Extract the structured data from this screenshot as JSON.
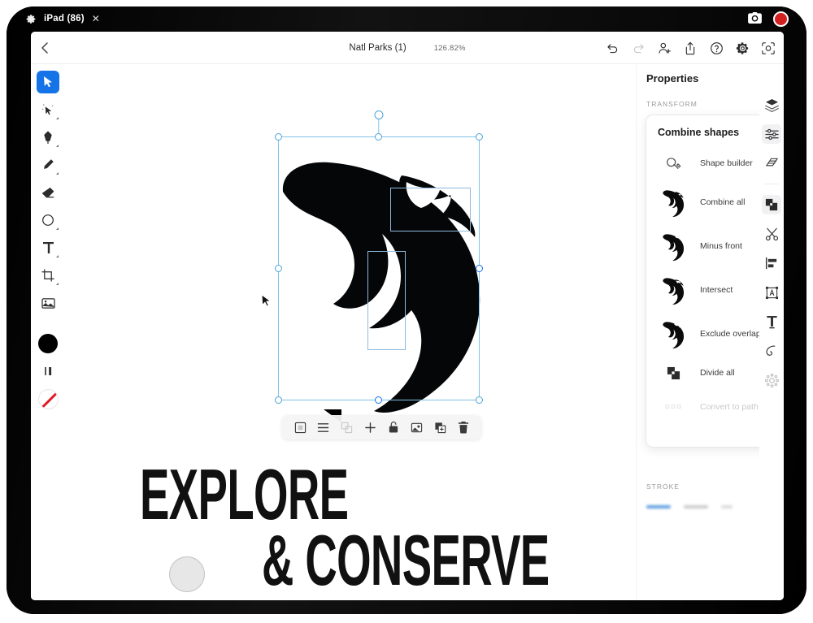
{
  "statusbar": {
    "gear_icon": "gear-icon",
    "device_label": "iPad (86)",
    "close_label": "✕",
    "camera_icon": "camera-icon",
    "record_icon": "record-button"
  },
  "appbar": {
    "back_icon": "chevron-left-icon",
    "doc_title": "Natl Parks (1)",
    "zoom_level": "126.82%",
    "right_icons": [
      {
        "name": "undo-icon",
        "state": "enabled"
      },
      {
        "name": "redo-icon",
        "state": "disabled"
      },
      {
        "name": "add-collaborator-icon",
        "state": "enabled"
      },
      {
        "name": "share-icon",
        "state": "enabled"
      },
      {
        "name": "help-icon",
        "state": "enabled"
      },
      {
        "name": "settings-gear-icon",
        "state": "enabled"
      },
      {
        "name": "preview-icon",
        "state": "enabled"
      }
    ]
  },
  "left_toolbar": {
    "items": [
      {
        "name": "select-tool",
        "label": "Select",
        "active": true
      },
      {
        "name": "direct-select-tool",
        "label": "Direct select",
        "active": false
      },
      {
        "name": "pen-tool",
        "label": "Pen",
        "active": false
      },
      {
        "name": "pencil-tool",
        "label": "Pencil",
        "active": false
      },
      {
        "name": "eraser-tool",
        "label": "Eraser",
        "active": false
      },
      {
        "name": "shape-tool",
        "label": "Shape",
        "active": false
      },
      {
        "name": "text-tool",
        "label": "Type",
        "active": false
      },
      {
        "name": "crop-tool",
        "label": "Crop",
        "active": false
      },
      {
        "name": "image-tool",
        "label": "Place image",
        "active": false
      }
    ],
    "fill_color": "#000000",
    "fill_label": "Fill",
    "stroke_width_label": "Stroke width",
    "stroke_color": "none",
    "stroke_label": "Stroke"
  },
  "canvas": {
    "artwork_name": "fish-silhouette",
    "artwork_color": "#040608",
    "selection": {
      "accent": "#4da3d6",
      "handles": 8,
      "sub_selections": 2
    },
    "headline_line1": "EXPLORE",
    "headline_line2": "& CONSERVE",
    "context_toolbar": [
      {
        "name": "frame-icon",
        "label": "Frame",
        "state": "enabled"
      },
      {
        "name": "list-icon",
        "label": "Arrange",
        "state": "enabled"
      },
      {
        "name": "group-icon",
        "label": "Group",
        "state": "disabled"
      },
      {
        "name": "add-icon",
        "label": "Add",
        "state": "enabled"
      },
      {
        "name": "lock-icon",
        "label": "Lock",
        "state": "enabled"
      },
      {
        "name": "mask-icon",
        "label": "Mask",
        "state": "enabled"
      },
      {
        "name": "duplicate-icon",
        "label": "Duplicate",
        "state": "enabled"
      },
      {
        "name": "trash-icon",
        "label": "Delete",
        "state": "enabled"
      }
    ]
  },
  "properties_panel": {
    "title": "Properties",
    "transform_label": "TRANSFORM",
    "stroke_label": "STROKE",
    "combine_shapes": {
      "header": "Combine shapes",
      "header_arrow": "→",
      "items": [
        {
          "name": "shape-builder-item",
          "label": "Shape builder",
          "thumb": "shape-builder-icon",
          "state": "enabled"
        },
        {
          "name": "combine-all-item",
          "label": "Combine all",
          "thumb": "fish-thumb",
          "state": "enabled"
        },
        {
          "name": "minus-front-item",
          "label": "Minus front",
          "thumb": "fish-thumb",
          "state": "enabled"
        },
        {
          "name": "intersect-item",
          "label": "Intersect",
          "thumb": "fish-thumb",
          "state": "enabled"
        },
        {
          "name": "exclude-overlap-item",
          "label": "Exclude overlap",
          "thumb": "fish-thumb",
          "state": "enabled"
        },
        {
          "name": "divide-all-item",
          "label": "Divide all",
          "thumb": "divide-icon",
          "state": "enabled"
        },
        {
          "name": "convert-to-path-item",
          "label": "Convert to path",
          "thumb": "path-icon",
          "state": "disabled"
        }
      ]
    }
  },
  "right_rail": {
    "items": [
      {
        "name": "layers-icon",
        "label": "Layers",
        "active": false
      },
      {
        "name": "properties-icon",
        "label": "Properties",
        "active": true
      },
      {
        "name": "grid-icon",
        "label": "Grids",
        "active": false
      },
      {
        "name": "combine-shapes-icon",
        "label": "Combine shapes",
        "active": true
      },
      {
        "name": "scissors-icon",
        "label": "Scissors",
        "active": false
      },
      {
        "name": "align-icon",
        "label": "Align",
        "active": false
      },
      {
        "name": "transform-icon",
        "label": "Transform",
        "active": false
      },
      {
        "name": "type-icon",
        "label": "Type",
        "active": false
      },
      {
        "name": "path-icon",
        "label": "Path",
        "active": false
      },
      {
        "name": "repeat-icon",
        "label": "Repeat",
        "active": false
      }
    ]
  }
}
